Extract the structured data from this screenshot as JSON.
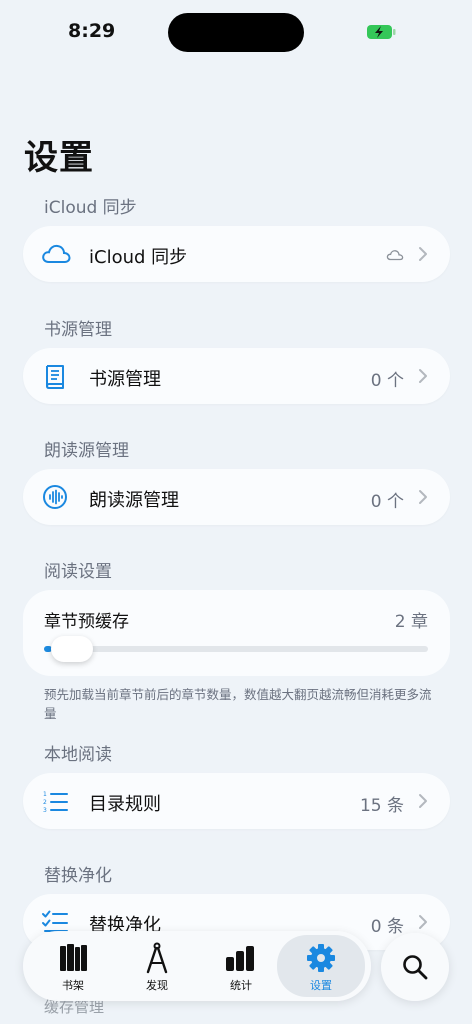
{
  "status_bar": {
    "time": "8:29"
  },
  "page": {
    "title": "设置"
  },
  "sections": {
    "icloud": {
      "header": "iCloud 同步",
      "label": "iCloud 同步"
    },
    "book_source": {
      "header": "书源管理",
      "label": "书源管理",
      "value": "0 个"
    },
    "tts_source": {
      "header": "朗读源管理",
      "label": "朗读源管理",
      "value": "0 个"
    },
    "reading": {
      "header": "阅读设置",
      "label": "章节预缓存",
      "value": "2 章",
      "slider_fraction": 0.02,
      "footnote": "预先加载当前章节前后的章节数量，数值越大翻页越流畅但消耗更多流量"
    },
    "local_reading": {
      "header": "本地阅读",
      "label": "目录规则",
      "value": "15 条"
    },
    "replace": {
      "header": "替换净化",
      "label": "替换净化",
      "value": "0 条"
    },
    "cache": {
      "header": "缓存管理"
    }
  },
  "tabbar": {
    "items": [
      {
        "label": "书架",
        "icon": "bookshelf-icon"
      },
      {
        "label": "发现",
        "icon": "compass-icon"
      },
      {
        "label": "统计",
        "icon": "chart-icon"
      },
      {
        "label": "设置",
        "icon": "gear-icon"
      }
    ],
    "active_index": 3,
    "accent_color": "#1a88e0"
  },
  "search": {
    "icon": "search-icon"
  }
}
